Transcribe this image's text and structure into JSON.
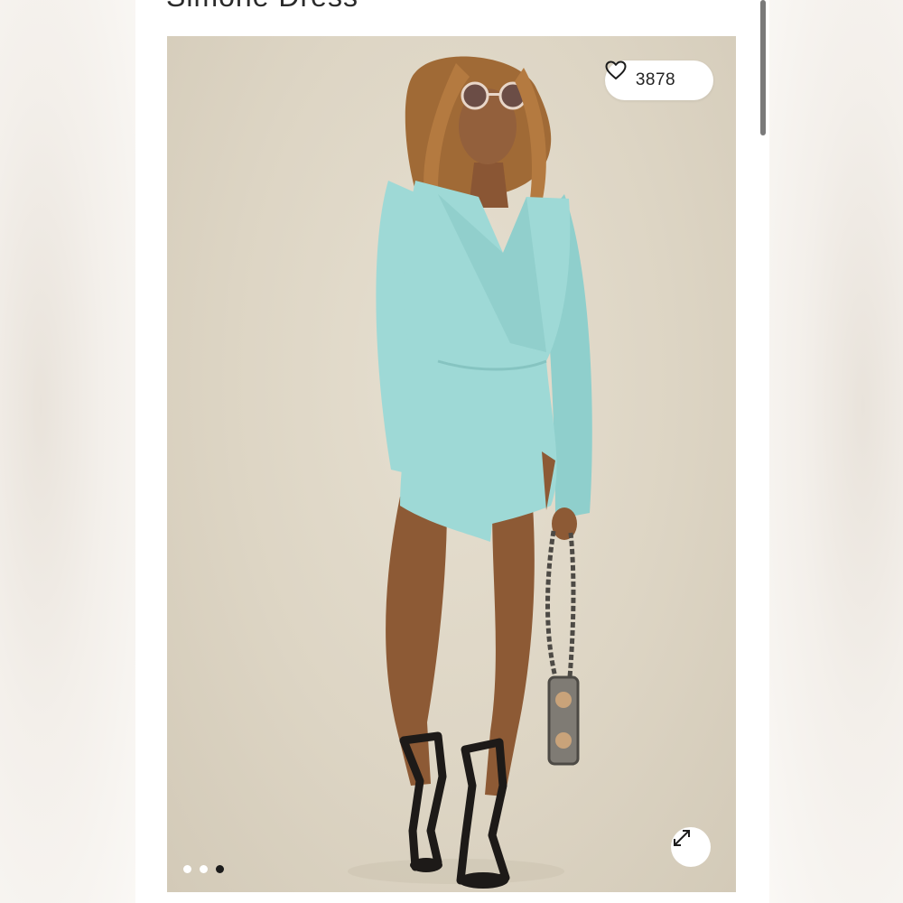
{
  "product": {
    "title": "Simone Dress"
  },
  "gallery": {
    "like_count": "3878",
    "like_icon": "heart-outline-icon",
    "expand_icon": "expand-arrows-icon",
    "image_count": 3,
    "active_index": 2
  },
  "colors": {
    "dress": "#9ed9d6",
    "backdrop": "#ddd5c4",
    "active_dot": "#1c1c1c"
  }
}
